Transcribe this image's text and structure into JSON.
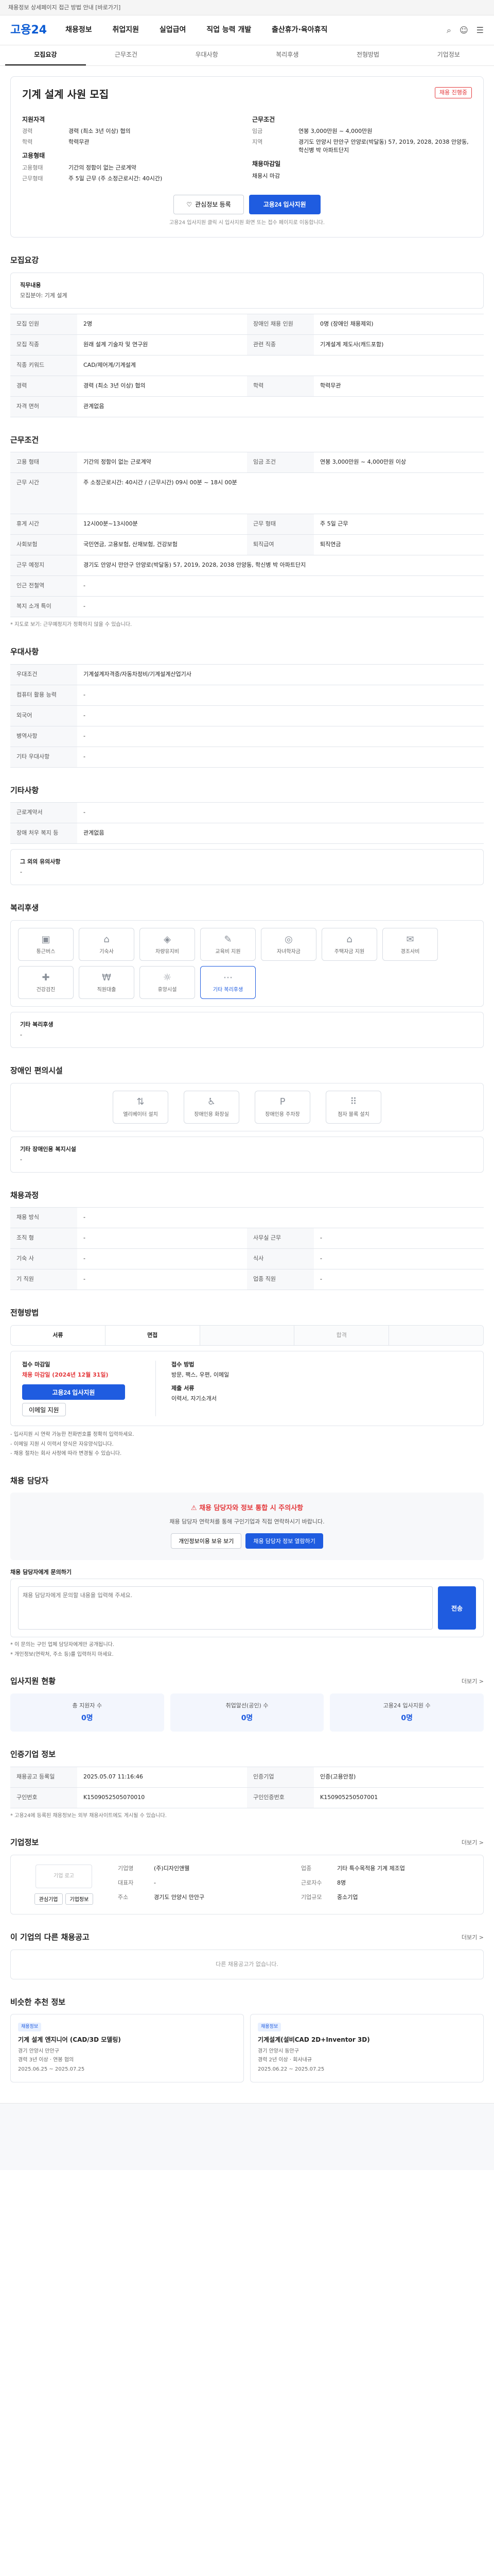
{
  "topbar": {
    "text": "채용정보 상세페이지 접근 방법 안내 [바로가기]"
  },
  "header": {
    "logo": "고용24",
    "nav": [
      "채용정보",
      "취업지원",
      "실업급여",
      "직업 능력 개발",
      "출산휴가·육아휴직"
    ]
  },
  "tabs": [
    "모집요강",
    "근무조건",
    "우대사항",
    "복리후생",
    "전형방법",
    "기업정보"
  ],
  "job": {
    "badge": "채용 진행중",
    "title": "기계 설계 사원 모집",
    "recruit_head": "지원자격",
    "recruit": [
      {
        "k": "경력",
        "v": "경력 (최소 3년 이상) 협의"
      },
      {
        "k": "학력",
        "v": "학력무관"
      }
    ],
    "cond_head": "근무조건",
    "cond": [
      {
        "k": "임금",
        "v": "연봉 3,000만원 ~ 4,000만원"
      },
      {
        "k": "지역",
        "v": "경기도 안양시 만안구 안양로(박달동) 57, 2019, 2028, 2038 안양동, 학신병 박 아파트단지"
      }
    ],
    "form_head": "고용형태",
    "form": [
      {
        "k": "고용형태",
        "v": "기간의 정함이 없는 근로계약"
      },
      {
        "k": "근무형태",
        "v": "주 5일 근무 (주 소정근로시간: 40시간)"
      }
    ],
    "deadline_head": "채용마감일",
    "deadline": "채용시 마감",
    "btn_save": "관심정보 등록",
    "btn_apply": "고용24 입사지원",
    "note": "고용24 입사지원 클릭 시 입사지원 화면 또는 접수 페이지로 이동합니다."
  },
  "recruit_section": {
    "title": "모집요강",
    "job_head": "직무내용",
    "job_body": "모집분야: 기계 설계",
    "rows": [
      [
        {
          "k": "모집 인원",
          "v": "2명"
        },
        {
          "k": "장애인 채용 인원",
          "v": "0명 (장애인 채용제외)"
        }
      ],
      [
        {
          "k": "모집 직종",
          "v": "원래 설계 기술자 및 연구원"
        },
        {
          "k": "관련 직종",
          "v": "기계설계 제도사(캐드포함)"
        }
      ],
      [
        {
          "k": "직종 키워드",
          "v": "CAD/제어계/기계설계"
        },
        {
          "k": "",
          "v": ""
        }
      ],
      [
        {
          "k": "경력",
          "v": "경력 (최소 3년 이상) 협의"
        },
        {
          "k": "학력",
          "v": "학력무관"
        }
      ],
      [
        {
          "k": "자격 면허",
          "v": "관계없음"
        },
        {
          "k": "",
          "v": ""
        }
      ]
    ]
  },
  "work_section": {
    "title": "근무조건",
    "rows": [
      [
        {
          "k": "고용 형태",
          "v": "기간의 정함이 없는 근로계약"
        },
        {
          "k": "임금 조건",
          "v": "연봉 3,000만원 ~ 4,000만원 이상"
        }
      ],
      [
        {
          "k": "근무 시간",
          "v": "주 소정근로시간: 40시간 / (근무시간) 09시 00분 ~ 18시 00분"
        },
        {
          "k": "",
          "v": ""
        }
      ],
      [
        {
          "k": "휴게 시간",
          "v": "12시00분~13시00분"
        },
        {
          "k": "근무 형태",
          "v": "주 5일 근무"
        }
      ],
      [
        {
          "k": "사회보험",
          "v": "국민연금, 고용보험, 산재보험, 건강보험"
        },
        {
          "k": "퇴직급여",
          "v": "퇴직연금"
        }
      ],
      [
        {
          "k": "근무 예정지",
          "v": "경기도 안양시 만안구 안양로(박달동) 57, 2019, 2028, 2038 안양동, 학신병 박 아파트단지"
        },
        {
          "k": "",
          "v": ""
        }
      ],
      [
        {
          "k": "인근 전철역",
          "v": "-"
        },
        {
          "k": "",
          "v": ""
        }
      ],
      [
        {
          "k": "복지 소개 특이",
          "v": "-"
        },
        {
          "k": "",
          "v": ""
        }
      ]
    ],
    "note": "* 지도로 보기: 근무예정지가 정확하지 않을 수 있습니다."
  },
  "prefer_section": {
    "title": "우대사항",
    "rows": [
      {
        "k": "우대조건",
        "v": "기계설계자격증/자동차정비/기계설계산업기사"
      },
      {
        "k": "컴퓨터 활용 능력",
        "v": "-"
      },
      {
        "k": "외국어",
        "v": "-"
      },
      {
        "k": "병역사항",
        "v": "-"
      },
      {
        "k": "기타 우대사항",
        "v": "-"
      }
    ]
  },
  "etc_section": {
    "title": "기타사항",
    "rows": [
      {
        "k": "근로계약서",
        "v": "-"
      },
      {
        "k": "장애 처우 복지 등",
        "v": "관계없음"
      }
    ],
    "extra_head": "그 외의 유의사항",
    "extra_body": "-"
  },
  "welfare_section": {
    "title": "복리후생",
    "items": [
      "통근버스",
      "기숙사",
      "차량유지비",
      "교육비 지원",
      "자녀학자금",
      "주택자금 지원",
      "경조사비",
      "건강검진",
      "직원대출",
      "휴양시설",
      "기타 복리후생"
    ],
    "etc_head": "기타 복리후생",
    "etc_body": "-"
  },
  "disabled_section": {
    "title": "장애인 편의시설",
    "items": [
      "엘리베이터 설치",
      "장애인용 화장실",
      "장애인용 주차장",
      "점자 블록 설치"
    ],
    "etc_head": "기타 장애인용 복지시설",
    "etc_body": "-"
  },
  "process_section": {
    "title": "채용과정",
    "rows": [
      [
        {
          "k": "채용 방식",
          "v": "-"
        },
        {
          "k": "",
          "v": ""
        }
      ],
      [
        {
          "k": "조직 형",
          "v": "-"
        },
        {
          "k": "사무실 근무",
          "v": "-"
        }
      ],
      [
        {
          "k": "기숙 사",
          "v": "-"
        },
        {
          "k": "식사",
          "v": "-"
        }
      ],
      [
        {
          "k": "기 직원",
          "v": "-"
        },
        {
          "k": "업종 직원",
          "v": "-"
        }
      ]
    ]
  },
  "selection_section": {
    "title": "전형방법",
    "steps": [
      "서류",
      "면접",
      "",
      "합격",
      ""
    ],
    "apply_head": "접수 마감일",
    "apply_deadline": "채용 마감일 (2024년 12월 31일)",
    "apply_btn": "고용24 입사지원",
    "apply_btn2": "이메일 지원",
    "method_head": "접수 방법",
    "method_body": "방문, 팩스, 우편, 이메일",
    "doc_head": "제출 서류",
    "doc_body": "이력서, 자기소개서",
    "notes": [
      "- 입사지원 시 연락 가능한 전화번호를 정확히 입력하세요.",
      "- 이메일 지원 시 이력서 양식은 자유양식입니다.",
      "- 채용 절차는 회사 사정에 따라 변경될 수 있습니다."
    ]
  },
  "contact_section": {
    "title": "채용 담당자",
    "warn_head": "채용 담당자와 정보 통합 시 주의사항",
    "warn_body": "채용 담당자 연락처를 통해 구인기업과 직접 연락하시기 바랍니다.",
    "btn1": "개인정보이용 보유 보기",
    "btn2": "채용 담당자 정보 열람하기",
    "inquiry_head": "채용 담당자에게 문의하기",
    "inquiry_placeholder": "채용 담당자에게 문의할 내용을 입력해 주세요.",
    "inquiry_btn": "전송",
    "notes": [
      "* 이 문의는 구인 업체 담당자에게만 공개됩니다.",
      "* 개인정보(연락처, 주소 등)를 입력하지 마세요."
    ]
  },
  "stats_section": {
    "title": "입사지원 현황",
    "more": "더보기 >",
    "items": [
      {
        "lab": "총 지원자 수",
        "num": "0명"
      },
      {
        "lab": "취업알선(공인) 수",
        "num": "0명"
      },
      {
        "lab": "고용24 입사지원 수",
        "num": "0명"
      }
    ]
  },
  "info_section": {
    "title": "인증기업 정보",
    "rows": [
      [
        {
          "k": "채용공고 등록일",
          "v": "2025.05.07 11:16:46"
        },
        {
          "k": "인증기업",
          "v": "인증(고용안정)"
        }
      ],
      [
        {
          "k": "구인번호",
          "v": "K1509052505070010"
        },
        {
          "k": "구인인증번호",
          "v": "K150905250507001"
        }
      ]
    ],
    "note": "* 고용24에 등록된 채용정보는 외부 채용사이트에도 게시될 수 있습니다."
  },
  "company_section": {
    "title": "기업정보",
    "more": "더보기 >",
    "logo_alt": "기업 로고",
    "btn1": "관심기업",
    "btn2": "기업정보",
    "rows": [
      {
        "k": "기업명",
        "v": "(주)디자인앤웰"
      },
      {
        "k": "업종",
        "v": "기타 특수목적용 기계 제조업"
      },
      {
        "k": "대표자",
        "v": "-"
      },
      {
        "k": "근로자수",
        "v": "8명"
      },
      {
        "k": "주소",
        "v": "경기도 안양시 만안구"
      },
      {
        "k": "기업규모",
        "v": "중소기업"
      }
    ]
  },
  "other_section": {
    "title": "이 기업의 다른 채용공고",
    "more": "더보기 >",
    "empty": "다른 채용공고가 없습니다."
  },
  "recommend_section": {
    "title": "비슷한 추천 정보",
    "items": [
      {
        "tag": "채용정보",
        "title": "기계 설계 엔지니어 (CAD/3D 모델링)",
        "meta1": "경기 안양시 만안구",
        "meta2": "경력 3년 이상 · 연봉 협의",
        "meta3": "2025.06.25 ~ 2025.07.25"
      },
      {
        "tag": "채용정보",
        "title": "기계설계(설비CAD 2D+Inventor 3D)",
        "meta1": "경기 안양시 동안구",
        "meta2": "경력 2년 이상 · 회사내규",
        "meta3": "2025.06.22 ~ 2025.07.25"
      }
    ]
  }
}
